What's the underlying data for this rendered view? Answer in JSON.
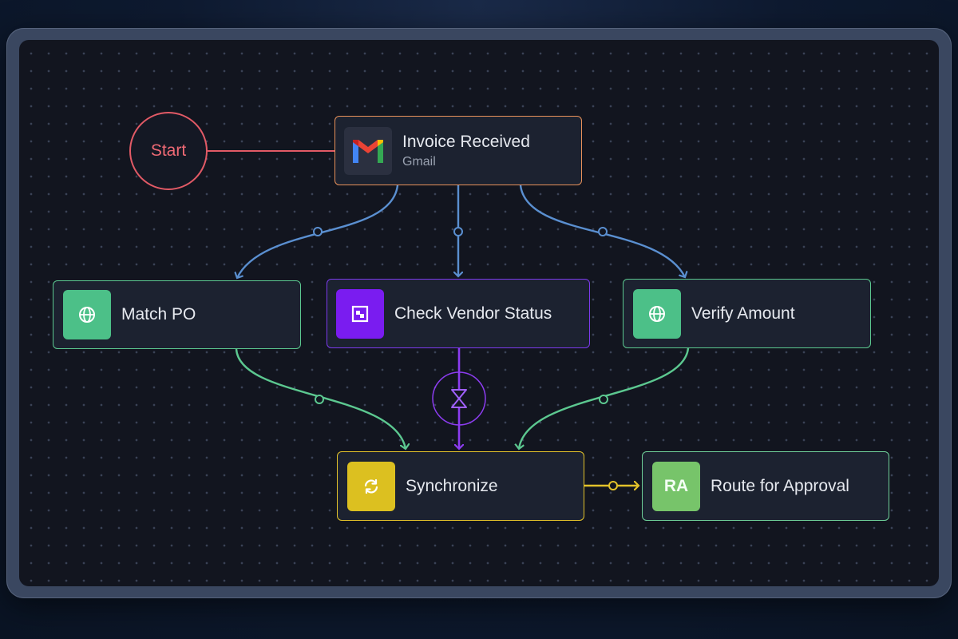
{
  "start": {
    "label": "Start"
  },
  "nodes": {
    "invoice_received": {
      "title": "Invoice Received",
      "subtitle": "Gmail",
      "icon": "gmail-icon",
      "color": "#e8915a"
    },
    "match_po": {
      "title": "Match PO",
      "icon": "globe-icon",
      "color": "#5cc890"
    },
    "check_vendor_status": {
      "title": "Check Vendor Status",
      "icon": "scan-frame-icon",
      "color": "#7c3aed"
    },
    "verify_amount": {
      "title": "Verify Amount",
      "icon": "globe-icon",
      "color": "#5cc890"
    },
    "synchronize": {
      "title": "Synchronize",
      "icon": "sync-icon",
      "color": "#e3c22a"
    },
    "route_for_approval": {
      "title": "Route for Approval",
      "icon_text": "RA",
      "color": "#7bc96f"
    }
  },
  "colors": {
    "start": "#e25a66",
    "edge_trigger": "#5a8fd0",
    "edge_green": "#5cc890",
    "edge_purple": "#8c3cf0",
    "edge_yellow": "#e3c22a",
    "canvas": "#12151f"
  }
}
